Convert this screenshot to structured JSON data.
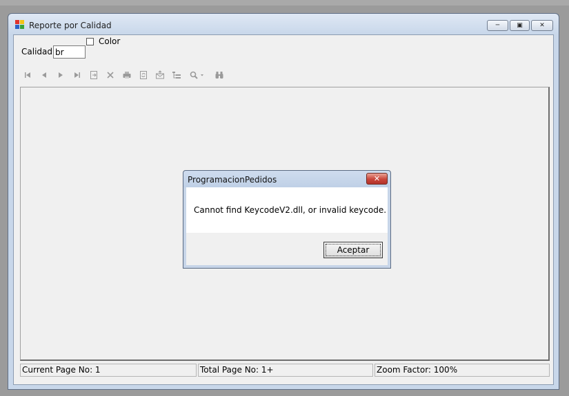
{
  "window": {
    "title": "Reporte por Calidad"
  },
  "form": {
    "color_checkbox_label": "Color",
    "color_checked": false,
    "calidad_label": "Calidad",
    "calidad_value": "br"
  },
  "toolbar": {
    "buttons": [
      {
        "name": "first-page",
        "icon": "first-page-icon"
      },
      {
        "name": "previous-page",
        "icon": "previous-page-icon"
      },
      {
        "name": "next-page",
        "icon": "next-page-icon"
      },
      {
        "name": "last-page",
        "icon": "last-page-icon"
      },
      {
        "name": "goto-page",
        "icon": "goto-page-icon"
      },
      {
        "name": "close-view",
        "icon": "close-icon"
      },
      {
        "name": "print",
        "icon": "printer-icon"
      },
      {
        "name": "refresh",
        "icon": "refresh-icon"
      },
      {
        "name": "export",
        "icon": "export-icon"
      },
      {
        "name": "group-tree",
        "icon": "tree-icon"
      },
      {
        "name": "zoom",
        "icon": "zoom-icon"
      },
      {
        "name": "search",
        "icon": "binoculars-icon"
      }
    ]
  },
  "status": {
    "current_page": "Current Page No: 1",
    "total_pages": "Total Page No: 1+",
    "zoom_factor": "Zoom Factor: 100%"
  },
  "dialog": {
    "title": "ProgramacionPedidos",
    "message": "Cannot find KeycodeV2.dll, or invalid keycode.",
    "ok_label": "Aceptar"
  },
  "colors": {
    "client_bg": "#f0f0f0",
    "title_bar": "#c8d7ea",
    "close_button": "#c9453a"
  }
}
